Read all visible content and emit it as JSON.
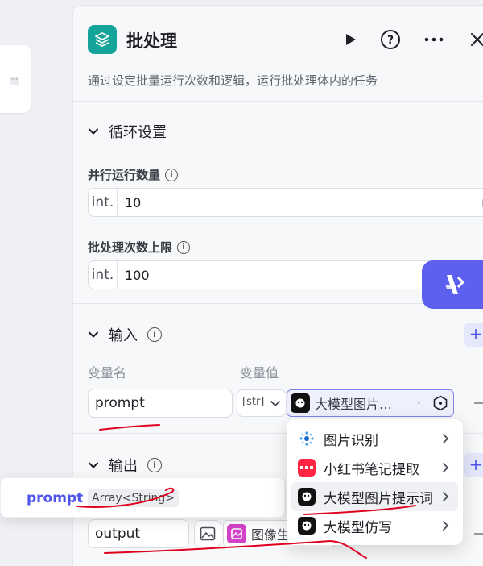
{
  "panel": {
    "title": "批处理",
    "description": "通过设定批量运行次数和逻辑，运行批处理体内的任务"
  },
  "loop_section": {
    "title": "循环设置",
    "parallel": {
      "label": "并行运行数量",
      "prefix": "int.",
      "value": "10"
    },
    "batch_limit": {
      "label": "批处理次数上限",
      "prefix": "int.",
      "value": "100"
    }
  },
  "input_section": {
    "title": "输入",
    "col_name": "变量名",
    "col_value": "变量值",
    "row": {
      "name": "prompt",
      "type_label": "[str]",
      "ref_label": "大模型图片…",
      "ref_dot": "·"
    }
  },
  "output_section": {
    "title": "输出",
    "row": {
      "name": "output",
      "ref_label": "图像生"
    }
  },
  "tooltip": {
    "name": "prompt",
    "type": "Array<String>"
  },
  "menu": {
    "items": [
      {
        "label": "图片识别"
      },
      {
        "label": "小红书笔记提取"
      },
      {
        "label": "大模型图片提示词"
      },
      {
        "label": "大模型仿写"
      }
    ]
  },
  "canvas_node": {
    "dots": "···"
  },
  "colors": {
    "accent": "#4d53e8",
    "teal": "#14a49a",
    "annotation": "#e0001e"
  },
  "icons": [
    "layers-icon",
    "play-icon",
    "help-icon",
    "more-icon",
    "close-icon",
    "info-icon",
    "chevron-down-icon",
    "chevron-right-icon",
    "variable-icon",
    "add-icon",
    "image-icon",
    "llm-icon",
    "xiaohongshu-icon",
    "image-recognition-icon",
    "app-logo-icon"
  ]
}
